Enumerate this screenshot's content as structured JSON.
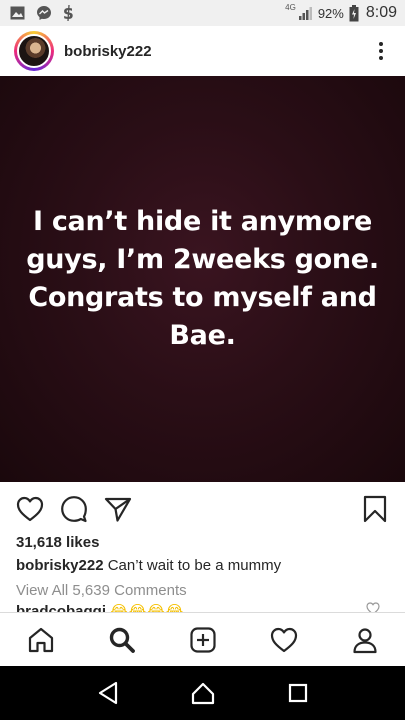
{
  "status_bar": {
    "network_type": "4G",
    "battery_percent": "92%",
    "time": "8:09",
    "notification_icons": [
      "image-icon",
      "messenger-icon",
      "dollar-app-icon"
    ]
  },
  "post": {
    "username": "bobrisky222",
    "image_text": "I can’t hide it anymore guys, I’m 2weeks gone. Congrats to myself and Bae.",
    "likes": "31,618 likes",
    "caption_user": "bobrisky222",
    "caption_text": "Can’t wait to be a mummy",
    "view_all_comments": "View All 5,639 Comments",
    "peek_comment_user": "bradcobaggi",
    "peek_comment_emojis": "😂😂😂😂"
  },
  "colors": {
    "post_background": "#2a0e16",
    "text_primary": "#262626",
    "text_secondary": "#8e8e8e"
  }
}
